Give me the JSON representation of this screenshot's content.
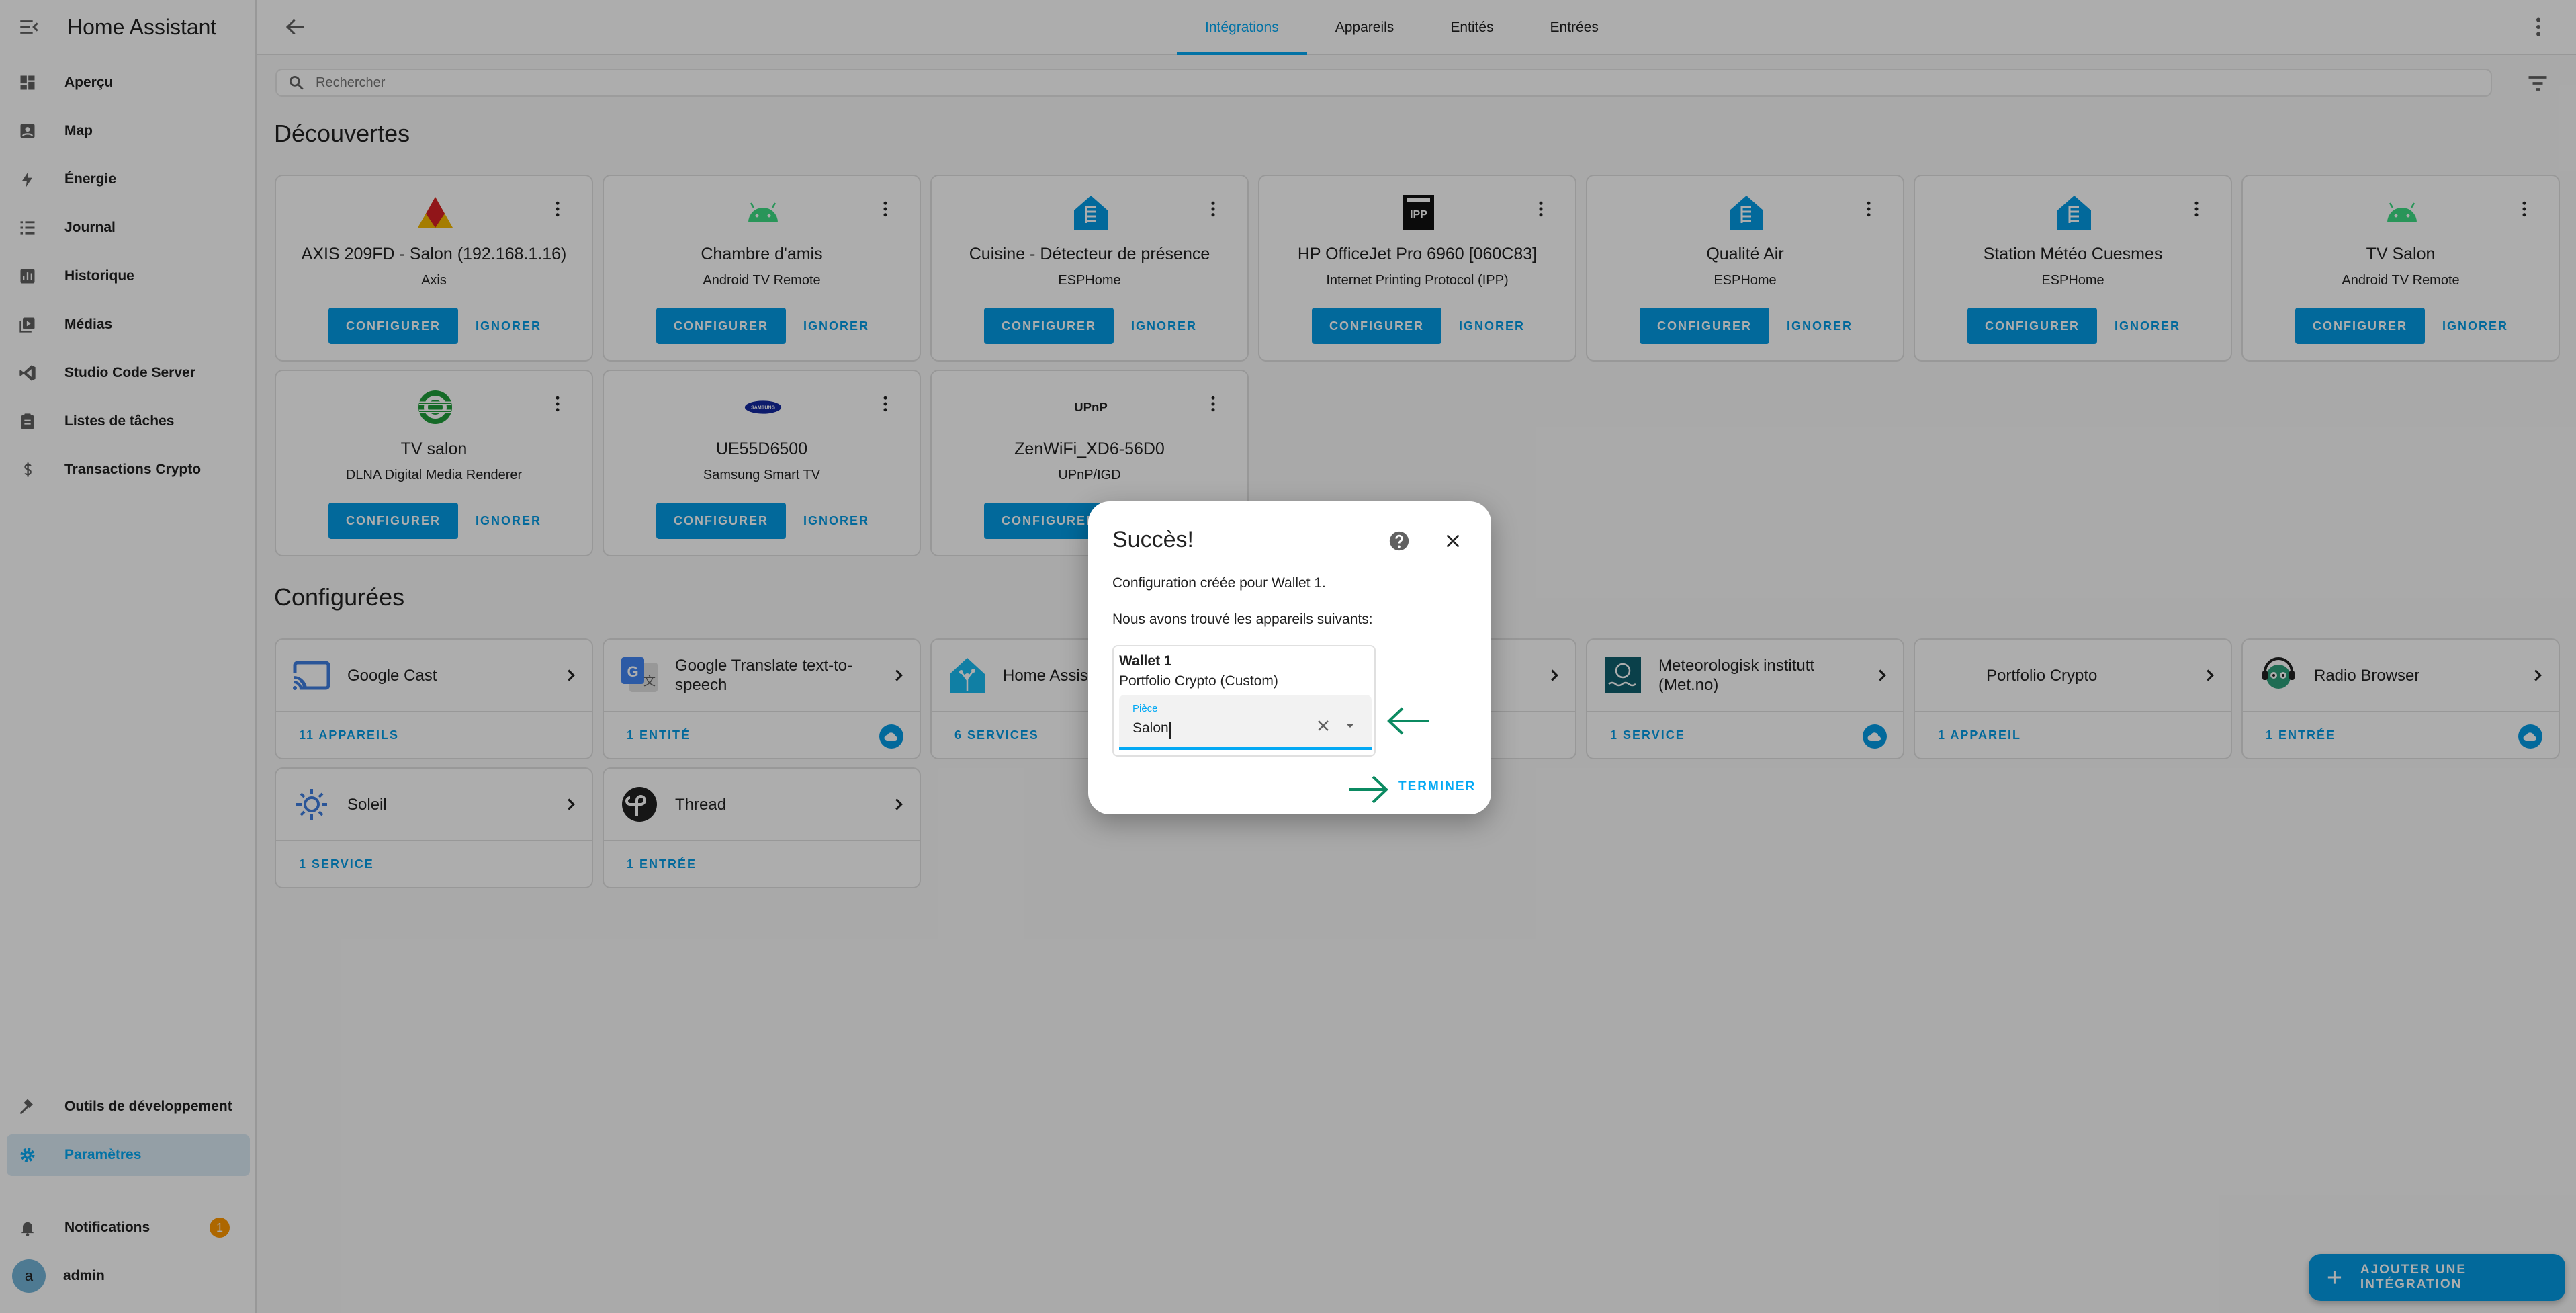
{
  "sidebar": {
    "title": "Home Assistant",
    "items": [
      {
        "label": "Aperçu",
        "icon": "dashboard-icon"
      },
      {
        "label": "Map",
        "icon": "map-icon"
      },
      {
        "label": "Énergie",
        "icon": "lightning-icon"
      },
      {
        "label": "Journal",
        "icon": "list-icon"
      },
      {
        "label": "Historique",
        "icon": "chart-icon"
      },
      {
        "label": "Médias",
        "icon": "media-icon"
      },
      {
        "label": "Studio Code Server",
        "icon": "vscode-icon"
      },
      {
        "label": "Listes de tâches",
        "icon": "clipboard-icon"
      },
      {
        "label": "Transactions Crypto",
        "icon": "dollar-icon"
      }
    ],
    "bottom": {
      "dev_tools": "Outils de développement",
      "settings": "Paramètres",
      "notifications": "Notifications",
      "notifications_count": "1",
      "user": "admin",
      "user_initial": "a"
    }
  },
  "topbar": {
    "tabs": [
      "Intégrations",
      "Appareils",
      "Entités",
      "Entrées"
    ],
    "active_tab": "Intégrations"
  },
  "search": {
    "placeholder": "Rechercher"
  },
  "sections": {
    "discovered": "Découvertes",
    "configured": "Configurées"
  },
  "buttons": {
    "configure": "CONFIGURER",
    "ignore": "IGNORER"
  },
  "discovered": [
    {
      "name": "AXIS 209FD - Salon (192.168.1.16)",
      "sub": "Axis"
    },
    {
      "name": "Chambre d'amis",
      "sub": "Android TV Remote"
    },
    {
      "name": "Cuisine - Détecteur de présence",
      "sub": "ESPHome"
    },
    {
      "name": "HP OfficeJet Pro 6960 [060C83]",
      "sub": "Internet Printing Protocol (IPP)"
    },
    {
      "name": "Qualité Air",
      "sub": "ESPHome"
    },
    {
      "name": "Station Météo Cuesmes",
      "sub": "ESPHome"
    },
    {
      "name": "TV Salon",
      "sub": "Android TV Remote"
    },
    {
      "name": "TV salon",
      "sub": "DLNA Digital Media Renderer"
    },
    {
      "name": "UE55D6500",
      "sub": "Samsung Smart TV"
    },
    {
      "name": "ZenWiFi_XD6-56D0",
      "sub": "UPnP/IGD"
    }
  ],
  "configured": [
    {
      "name": "Google Cast",
      "link": "11 APPAREILS"
    },
    {
      "name": "Google Translate text-to-speech",
      "link": "1 ENTITÉ"
    },
    {
      "name": "Home Assistant",
      "link": "6 SERVICES"
    },
    {
      "name": "Meteorologisk institutt (Met.no)",
      "link": "1 SERVICE"
    },
    {
      "name": "Portfolio Crypto",
      "link": "1 APPAREIL"
    },
    {
      "name": "Radio Browser",
      "link": "1 ENTRÉE"
    },
    {
      "name": "Soleil",
      "link": "1 SERVICE"
    },
    {
      "name": "Thread",
      "link": "1 ENTRÉE"
    }
  ],
  "logos": {
    "upnp": "UPnP",
    "samsung": "SAMSUNG",
    "ipp": "IPP"
  },
  "dialog": {
    "title": "Succès!",
    "message": "Configuration créée pour Wallet 1.",
    "devices_found": "Nous avons trouvé les appareils suivants:",
    "device_name": "Wallet 1",
    "device_model": "Portfolio Crypto (Custom)",
    "area_label": "Pièce",
    "area_value": "Salon",
    "finish": "TERMINER"
  },
  "fab": {
    "label": "AJOUTER UNE INTÉGRATION"
  },
  "colors": {
    "accent": "#03a9f4",
    "primary_button": "#039be5",
    "badge": "#ff9800",
    "arrow": "#0b8a61"
  }
}
